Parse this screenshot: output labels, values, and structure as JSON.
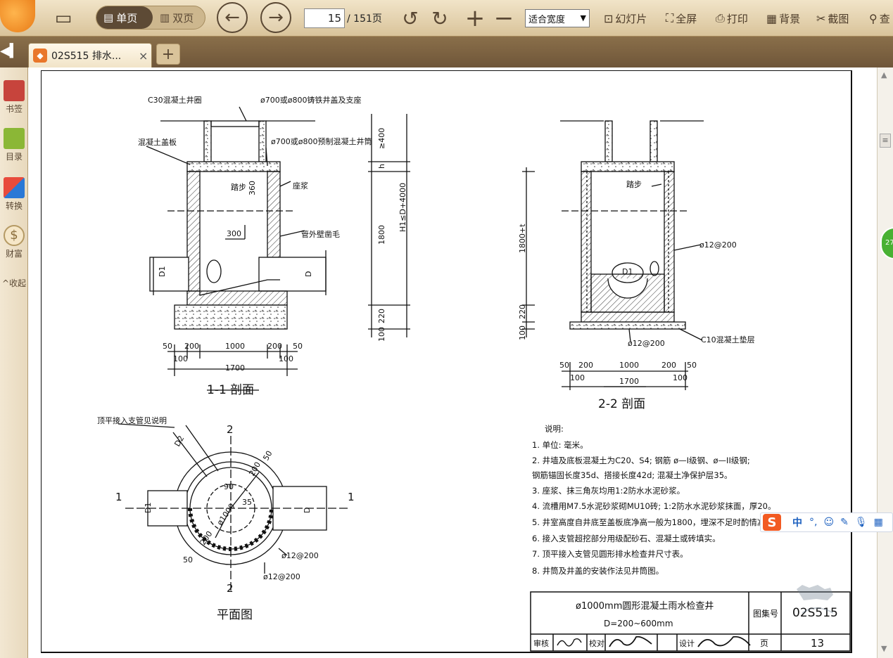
{
  "toolbar": {
    "single_page_label": "单页",
    "double_page_label": "双页",
    "current_page": "15",
    "total_pages": "/ 151页",
    "zoom_value": "适合宽度",
    "slideshow_label": "幻灯片",
    "fullscreen_label": "全屏",
    "print_label": "打印",
    "background_label": "背景",
    "screenshot_label": "截图",
    "search_label": "查"
  },
  "tabs": {
    "active_label": "02S515 排水...",
    "close_glyph": "×",
    "add_glyph": "+"
  },
  "sidebar": {
    "bookmark_label": "书签",
    "toc_label": "目录",
    "convert_label": "转换",
    "wealth_label": "财富",
    "collapse_label": "收起"
  },
  "badge": {
    "text": "27"
  },
  "ime": {
    "chinese": "中",
    "dot": "°,"
  },
  "drawing": {
    "sec11": {
      "title": "1-1 剖面",
      "label_cover_ring": "C30混凝土井圈",
      "label_cast_cover": "ø700或ø800铸铁井盖及支座",
      "label_cover_plate": "混凝土盖板",
      "label_shaft": "ø700或ø800预制混凝土井筒",
      "label_step": "踏步",
      "label_mortar": "座浆",
      "label_pipe_wall": "管外壁凿毛",
      "dim_360": "360",
      "dim_300": "300",
      "dim_1800": "1800",
      "dim_400": "≥400",
      "dim_h": "h",
      "dim_H1": "H1≤D+4000",
      "dim_220": "220",
      "dim_100": "100",
      "pipe_d1": "D1",
      "pipe_d": "D",
      "dims_bottom_top": [
        "50",
        "200",
        "1000",
        "200",
        "50"
      ],
      "dims_bottom_mid": [
        "100",
        "100"
      ],
      "dim_total": "1700"
    },
    "sec22": {
      "title": "2-2 剖面",
      "label_step": "踏步",
      "label_rebar1": "ø12@200",
      "label_rebar2": "ø12@200",
      "label_c10": "C10混凝土垫层",
      "pipe_d1": "D1",
      "dim_1800t": "1800+t",
      "dim_220": "220",
      "dim_100": "100",
      "dims_bottom_top": [
        "50",
        "200",
        "1000",
        "200",
        "50"
      ],
      "dims_bottom_mid": [
        "100",
        "100"
      ],
      "dim_total": "1700"
    },
    "plan": {
      "title": "平面图",
      "label_branch": "顶平接入支管见说明",
      "section_mark": "1",
      "section2_mark": "2",
      "pipe_d1": "D1",
      "pipe_d": "D",
      "pipe_d2": "D2",
      "dim_ø1000": "ø1000",
      "dim_ø35": "35",
      "dim_90": "90",
      "dim_200a": "200",
      "dim_50a": "50",
      "dim_200b": "200",
      "dim_50b": "50",
      "label_rebar1": "ø12@200",
      "label_rebar2": "ø12@200"
    },
    "notes": {
      "heading": "说明:",
      "lines": [
        "1. 单位: 毫米。",
        "2. 井墙及底板混凝土为C20、S4; 钢筋 ø—I级钢、ø—II级钢;",
        "    钢筋锚固长度35d、搭接长度42d; 混凝土净保护层35。",
        "3. 座浆、抹三角灰均用1:2防水水泥砂浆。",
        "4. 流槽用M7.5水泥砂浆砌MU10砖; 1:2防水水泥砂浆抹面，厚20。",
        "5. 井室高度自井底至盖板底净高一般为1800，埋深不足时酌情减少。",
        "6. 接入支管超挖部分用级配砂石、混凝土或砖填实。",
        "7. 顶平接入支管见圆形排水检查井尺寸表。",
        "8. 井筒及井盖的安装作法见井筒图。"
      ]
    },
    "titleblock": {
      "title": "ø1000mm圆形混凝土雨水检查井",
      "subtitle": "D=200~600mm",
      "atlas_label": "图集号",
      "atlas_no": "02S515",
      "page_label": "页",
      "page_no": "13",
      "review_label": "审核",
      "check_label": "校对",
      "design_label": "设计"
    }
  }
}
